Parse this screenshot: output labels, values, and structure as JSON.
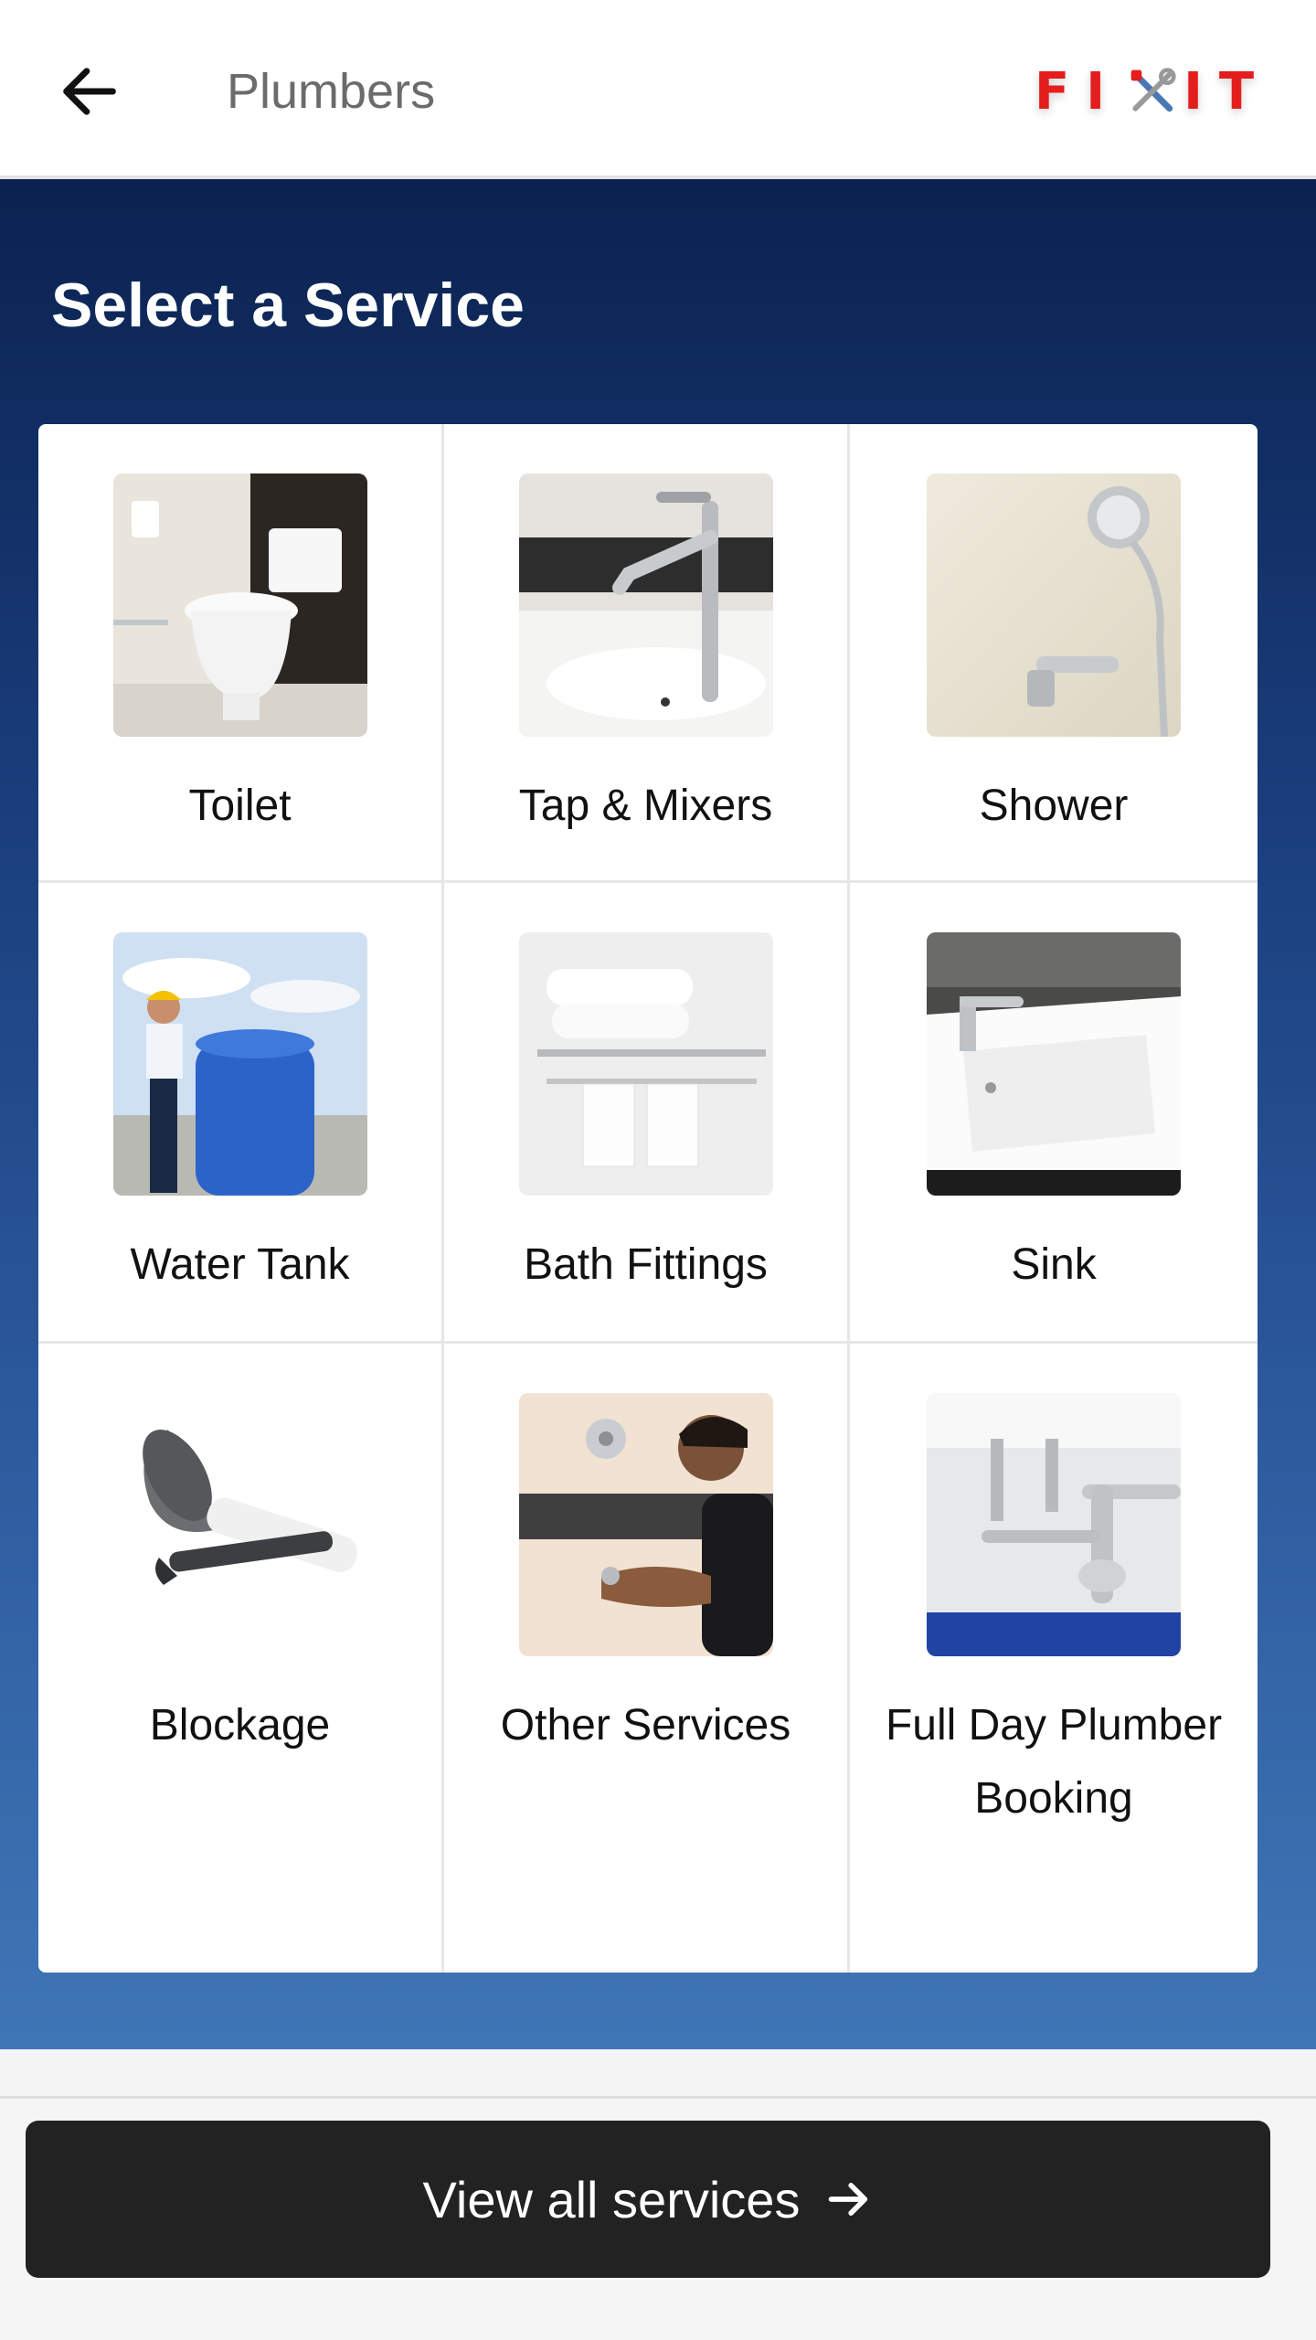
{
  "header": {
    "title": "Plumbers",
    "logo_text_left": "FI",
    "logo_text_right": "IT",
    "back_icon": "arrow-left-icon",
    "logo_icon": "wrench-screwdriver-icon"
  },
  "main": {
    "section_title": "Select a Service",
    "services": [
      {
        "label": "Toilet",
        "icon": "toilet-photo"
      },
      {
        "label": "Tap & Mixers",
        "icon": "tap-photo"
      },
      {
        "label": "Shower",
        "icon": "shower-photo"
      },
      {
        "label": "Water Tank",
        "icon": "water-tank-photo"
      },
      {
        "label": "Bath Fittings",
        "icon": "towel-rack-photo"
      },
      {
        "label": "Sink",
        "icon": "sink-photo"
      },
      {
        "label": "Blockage",
        "icon": "plunger-photo"
      },
      {
        "label": "Other Services",
        "icon": "plumber-photo"
      },
      {
        "label": "Full Day Plumber Booking",
        "icon": "pipes-photo"
      }
    ]
  },
  "footer": {
    "cta_label": "View all services",
    "cta_icon": "arrow-right-icon"
  },
  "colors": {
    "logo_red": "#e41d1d",
    "hero_top": "#0b2250",
    "hero_bottom": "#3f76b6",
    "button_bg": "#222222"
  }
}
